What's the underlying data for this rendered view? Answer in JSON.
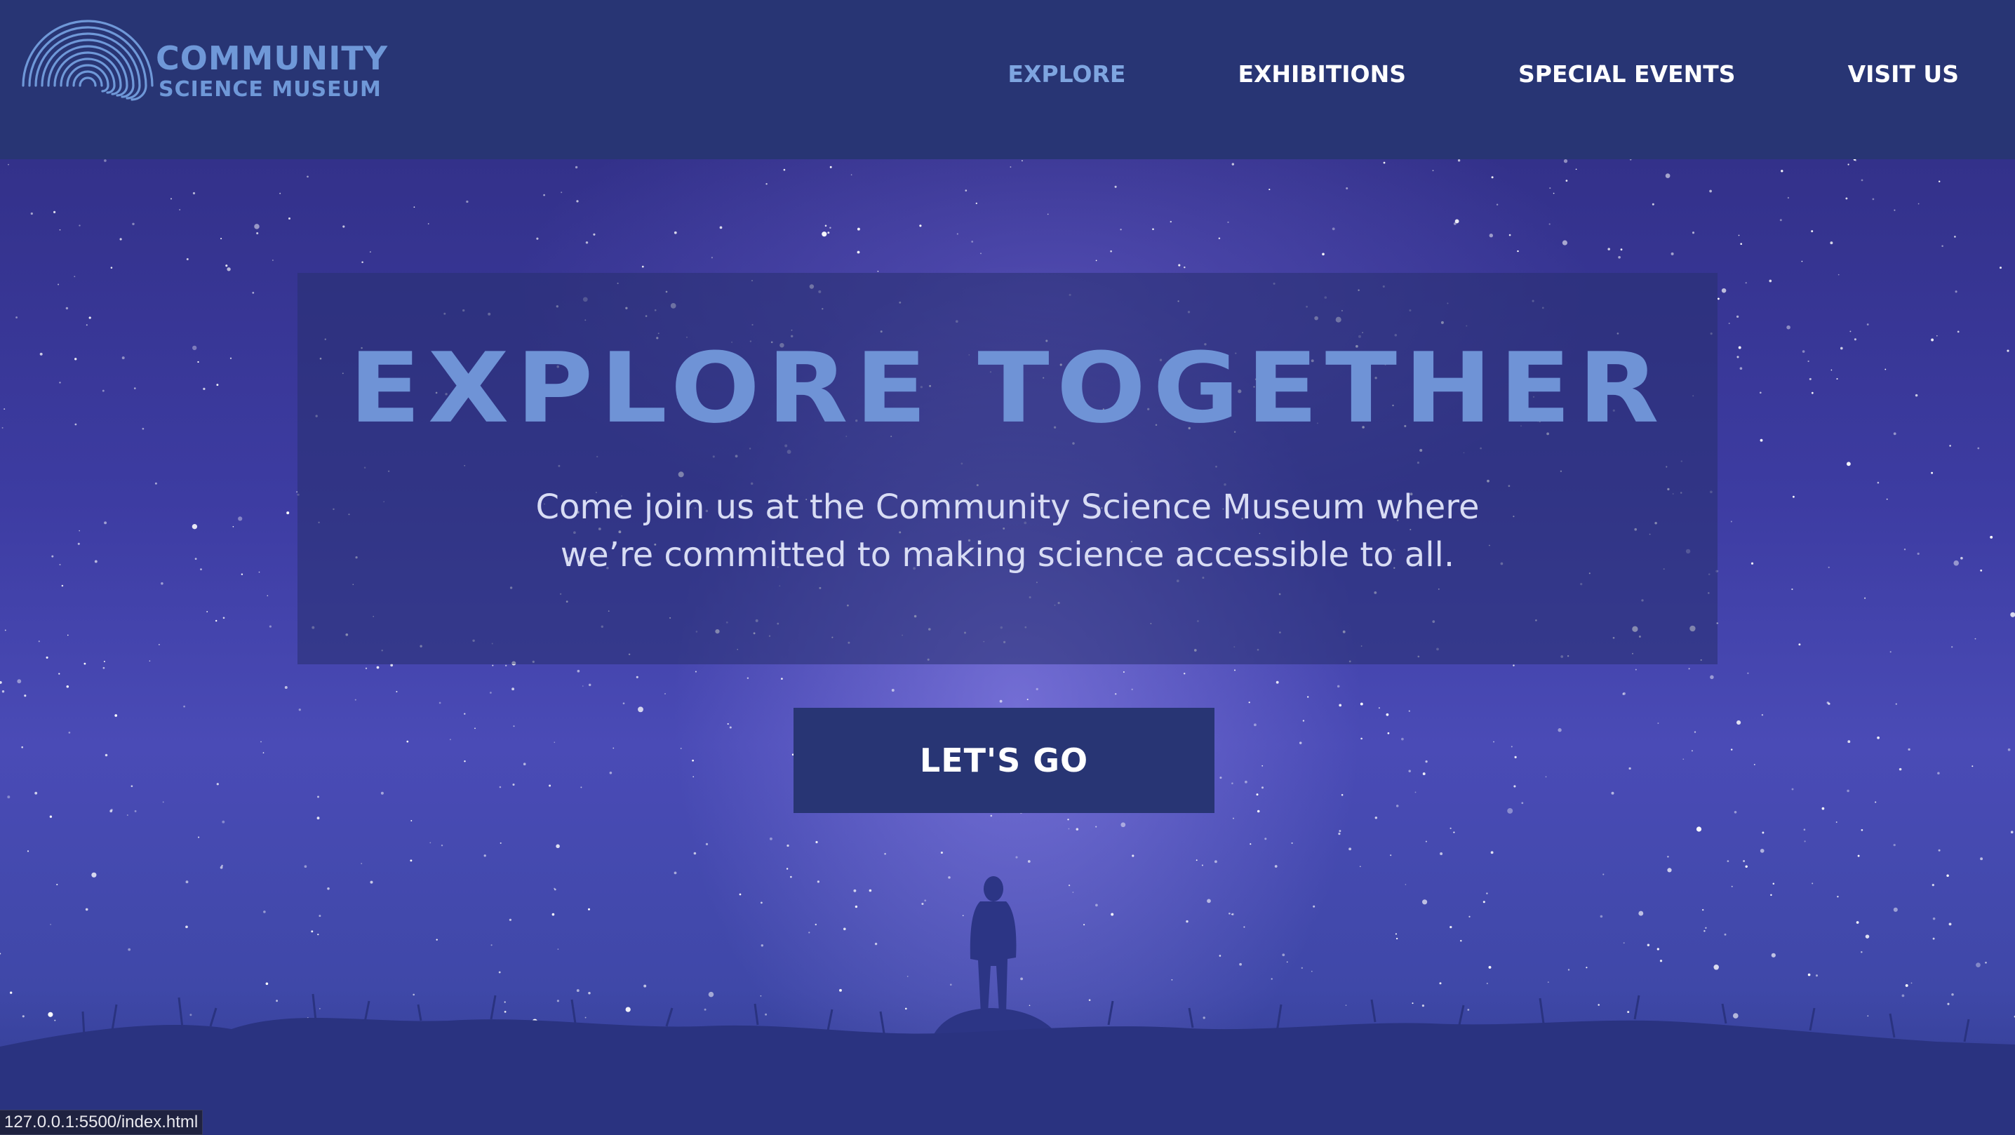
{
  "header": {
    "logo": {
      "line1": "COMMUNITY",
      "line2": "SCIENCE MUSEUM",
      "icon": "concentric-arcs-logo-icon",
      "color": "#6f98d8"
    },
    "nav": [
      {
        "label": "EXPLORE",
        "active": true
      },
      {
        "label": "EXHIBITIONS",
        "active": false
      },
      {
        "label": "SPECIAL EVENTS",
        "active": false
      },
      {
        "label": "VISIT US",
        "active": false
      }
    ],
    "background": "#283574"
  },
  "hero": {
    "headline": "EXPLORE TOGETHER",
    "subtext_line1": "Come join us at the Community Science Museum where",
    "subtext_line2": "we’re committed to making science accessible to all.",
    "cta_label": "LET'S GO",
    "background_image": "starry-night-sky-with-silhouette",
    "colors": {
      "headline": "#6f93d6",
      "cta_background": "#283574"
    }
  },
  "status_bar": {
    "url": "127.0.0.1:5500/index.html"
  }
}
